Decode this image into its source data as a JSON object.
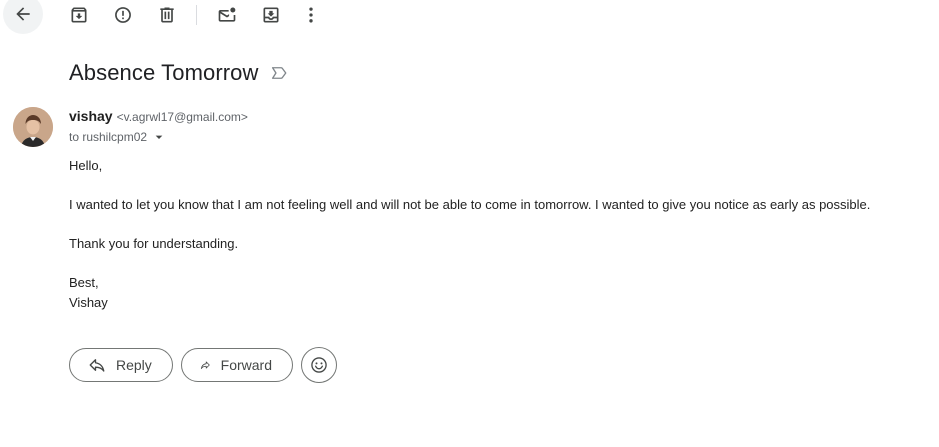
{
  "toolbar": {
    "icons": [
      "back-arrow-icon",
      "archive-icon",
      "report-spam-icon",
      "delete-icon",
      "mark-unread-icon",
      "move-to-icon",
      "more-vert-icon"
    ]
  },
  "message": {
    "subject": "Absence Tomorrow",
    "sender_name": "vishay",
    "sender_email": "<v.agrwl17@gmail.com>",
    "to_line": "to rushilcpm02",
    "body": {
      "greeting": "Hello,",
      "paragraph1": "I wanted to let you know that I am not feeling well and will not be able to come in tomorrow. I wanted to give you notice as early as possible.",
      "paragraph2": "Thank you for understanding.",
      "closing": "Best,",
      "signature": "Vishay"
    }
  },
  "actions": {
    "reply_label": "Reply",
    "forward_label": "Forward"
  },
  "colors": {
    "text_primary": "#202124",
    "text_secondary": "#5f6368",
    "icon": "#444746",
    "button_border": "#747775"
  }
}
